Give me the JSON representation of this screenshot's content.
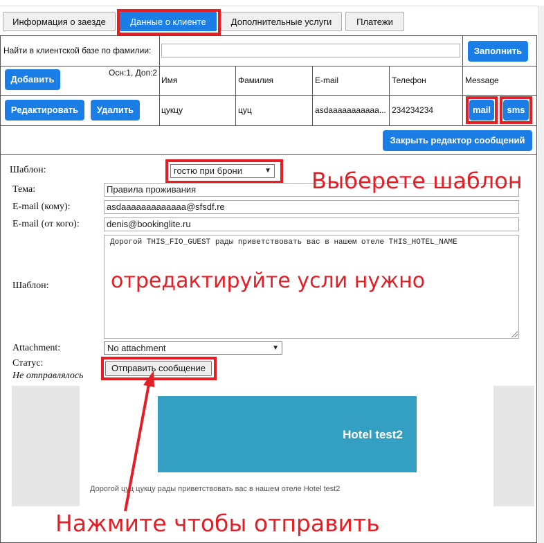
{
  "tabs": [
    {
      "label": "Информация о заезде"
    },
    {
      "label": "Данные о клиенте"
    },
    {
      "label": "Дополнительные услуги"
    },
    {
      "label": "Платежи"
    }
  ],
  "search": {
    "label": "Найти в клиентской базе по фамилии:",
    "value": "",
    "fill_button": "Заполнить"
  },
  "guests_header": {
    "add_button": "Добавить",
    "counts": "Осн:1, Доп:2",
    "columns": [
      "Имя",
      "Фамилия",
      "E-mail",
      "Телефон",
      "Message"
    ]
  },
  "guest_row": {
    "edit_button": "Редактировать",
    "delete_button": "Удалить",
    "first_name": "цукцу",
    "last_name": "цуц",
    "email": "asdaaaaaaaaaaa...",
    "phone": "234234234",
    "mail_button": "mail",
    "sms_button": "sms"
  },
  "close_editor_button": "Закрыть редактор сообщений",
  "form": {
    "template_label": "Шаблон:",
    "template_value": "гостю при брони",
    "subject_label": "Тема:",
    "subject_value": "Правила проживания",
    "email_to_label": "E-mail (кому):",
    "email_to_value": "asdaaaaaaaaaaaaa@sfsdf.re",
    "email_from_label": "E-mail (от кого):",
    "email_from_value": "denis@bookinglite.ru",
    "body_label": "Шаблон:",
    "body_value": "Дорогой THIS_FIO_GUEST рады приветствовать вас в нашем отеле THIS_HOTEL_NAME",
    "attachment_label": "Attachment:",
    "attachment_value": "No attachment",
    "status_label": "Статус:",
    "status_value": "Не отправлялось",
    "send_button": "Отправить сообщение"
  },
  "preview": {
    "hotel_name": "Hotel test2",
    "message": "Дорогой цуц цукцу рады приветствовать вас в нашем отеле Hotel test2"
  },
  "annotations": {
    "choose_template": "Выберете шаблон",
    "edit_if_needed": "отредактируйте усли нужно",
    "click_to_send": "Нажмите чтобы отправить"
  },
  "colors": {
    "accent": "#1a7ee6",
    "annotation_red": "#e51e25",
    "banner": "#339fc3"
  }
}
